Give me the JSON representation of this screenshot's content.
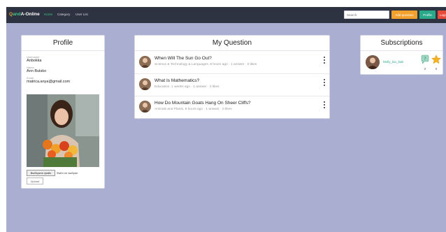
{
  "nav": {
    "brand_part1": "Q",
    "brand_part2": "and",
    "brand_part3": "A-Online",
    "links": [
      "Home",
      "Category",
      "User List"
    ],
    "search_placeholder": "Search",
    "ask_button": "Add question",
    "profile_button": "Profile",
    "logout_button": "Logout"
  },
  "profile": {
    "title": "Profile",
    "username_label": "Username",
    "username": "Anbokka",
    "name_label": "Name",
    "name": "Ann Butsko",
    "email_label": "Email",
    "email": "matrica.anya@gmail.com",
    "choose_file": "Выберите файл",
    "no_file": "Файл не выбран",
    "upload": "Upload"
  },
  "questions": {
    "title": "My Question",
    "items": [
      {
        "title": "When Will The Sun Go Out?",
        "meta": "Science & Technology & Languages, 8 hours ago · 1 answer · 0 likes"
      },
      {
        "title": "What Is Mathematics?",
        "meta": "Education, 1 weeks ago · 1 answer · 2 likes"
      },
      {
        "title": "How Do Mountain Goats Hang On Sheer Cliffs?",
        "meta": "Animals and Plants, 8 hours ago · 1 answer · 0 likes"
      }
    ]
  },
  "subscriptions": {
    "title": "Subscriptions",
    "items": [
      {
        "name": "Molly_lao_bab",
        "questions_count": "2",
        "stars_count": "0"
      }
    ]
  },
  "icons": {
    "question_icon": "question-bubble-icon",
    "star_icon": "star-icon",
    "kebab_icon": "more-vertical-icon"
  },
  "colors": {
    "navbar": "#2d3340",
    "background": "#aaaed0",
    "accent_green": "#3fc38a",
    "accent_orange": "#f2a02e",
    "teal": "#2aa98a",
    "red": "#e64a3c"
  }
}
